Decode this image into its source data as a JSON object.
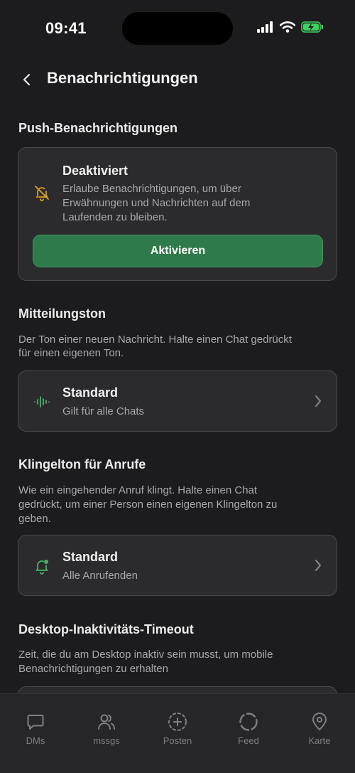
{
  "status_bar": {
    "time": "09:41"
  },
  "header": {
    "title": "Benachrichtigungen"
  },
  "push": {
    "section_title": "Push-Benachrichtigungen",
    "status_title": "Deaktiviert",
    "status_desc_1": "Erlaube Benachrichtigungen, um über",
    "status_desc_2": "Erwähnungen und Nachrichten auf dem",
    "status_desc_3": "Laufenden zu bleiben.",
    "activate_label": "Aktivieren"
  },
  "message_tone": {
    "section_title": "Mitteilungston",
    "desc_1": "Der Ton einer neuen Nachricht. Halte einen Chat gedrückt",
    "desc_2": "für einen eigenen Ton.",
    "value_title": "Standard",
    "value_sub": "Gilt für alle Chats"
  },
  "ringtone": {
    "section_title": "Klingelton für Anrufe",
    "desc_1": "Wie ein eingehender Anruf klingt. Halte einen Chat",
    "desc_2": "gedrückt, um einer Person einen eigenen Klingelton zu",
    "desc_3": "geben.",
    "value_title": "Standard",
    "value_sub": "Alle Anrufenden"
  },
  "desktop_timeout": {
    "section_title": "Desktop-Inaktivitäts-Timeout",
    "desc_1": "Zeit, die du am Desktop inaktiv sein musst, um mobile",
    "desc_2": "Benachrichtigungen zu erhalten"
  },
  "tabs": [
    {
      "label": "DMs",
      "icon": "chat-bubble-icon"
    },
    {
      "label": "mssgs",
      "icon": "people-icon"
    },
    {
      "label": "Posten",
      "icon": "plus-circle-icon"
    },
    {
      "label": "Feed",
      "icon": "circle-icon"
    },
    {
      "label": "Karte",
      "icon": "map-pin-icon"
    }
  ],
  "colors": {
    "background": "#1c1c1e",
    "card": "#2b2b2d",
    "accent_green": "#2f7a4a",
    "warning_yellow": "#d9a520",
    "icon_green": "#4caf6a"
  }
}
